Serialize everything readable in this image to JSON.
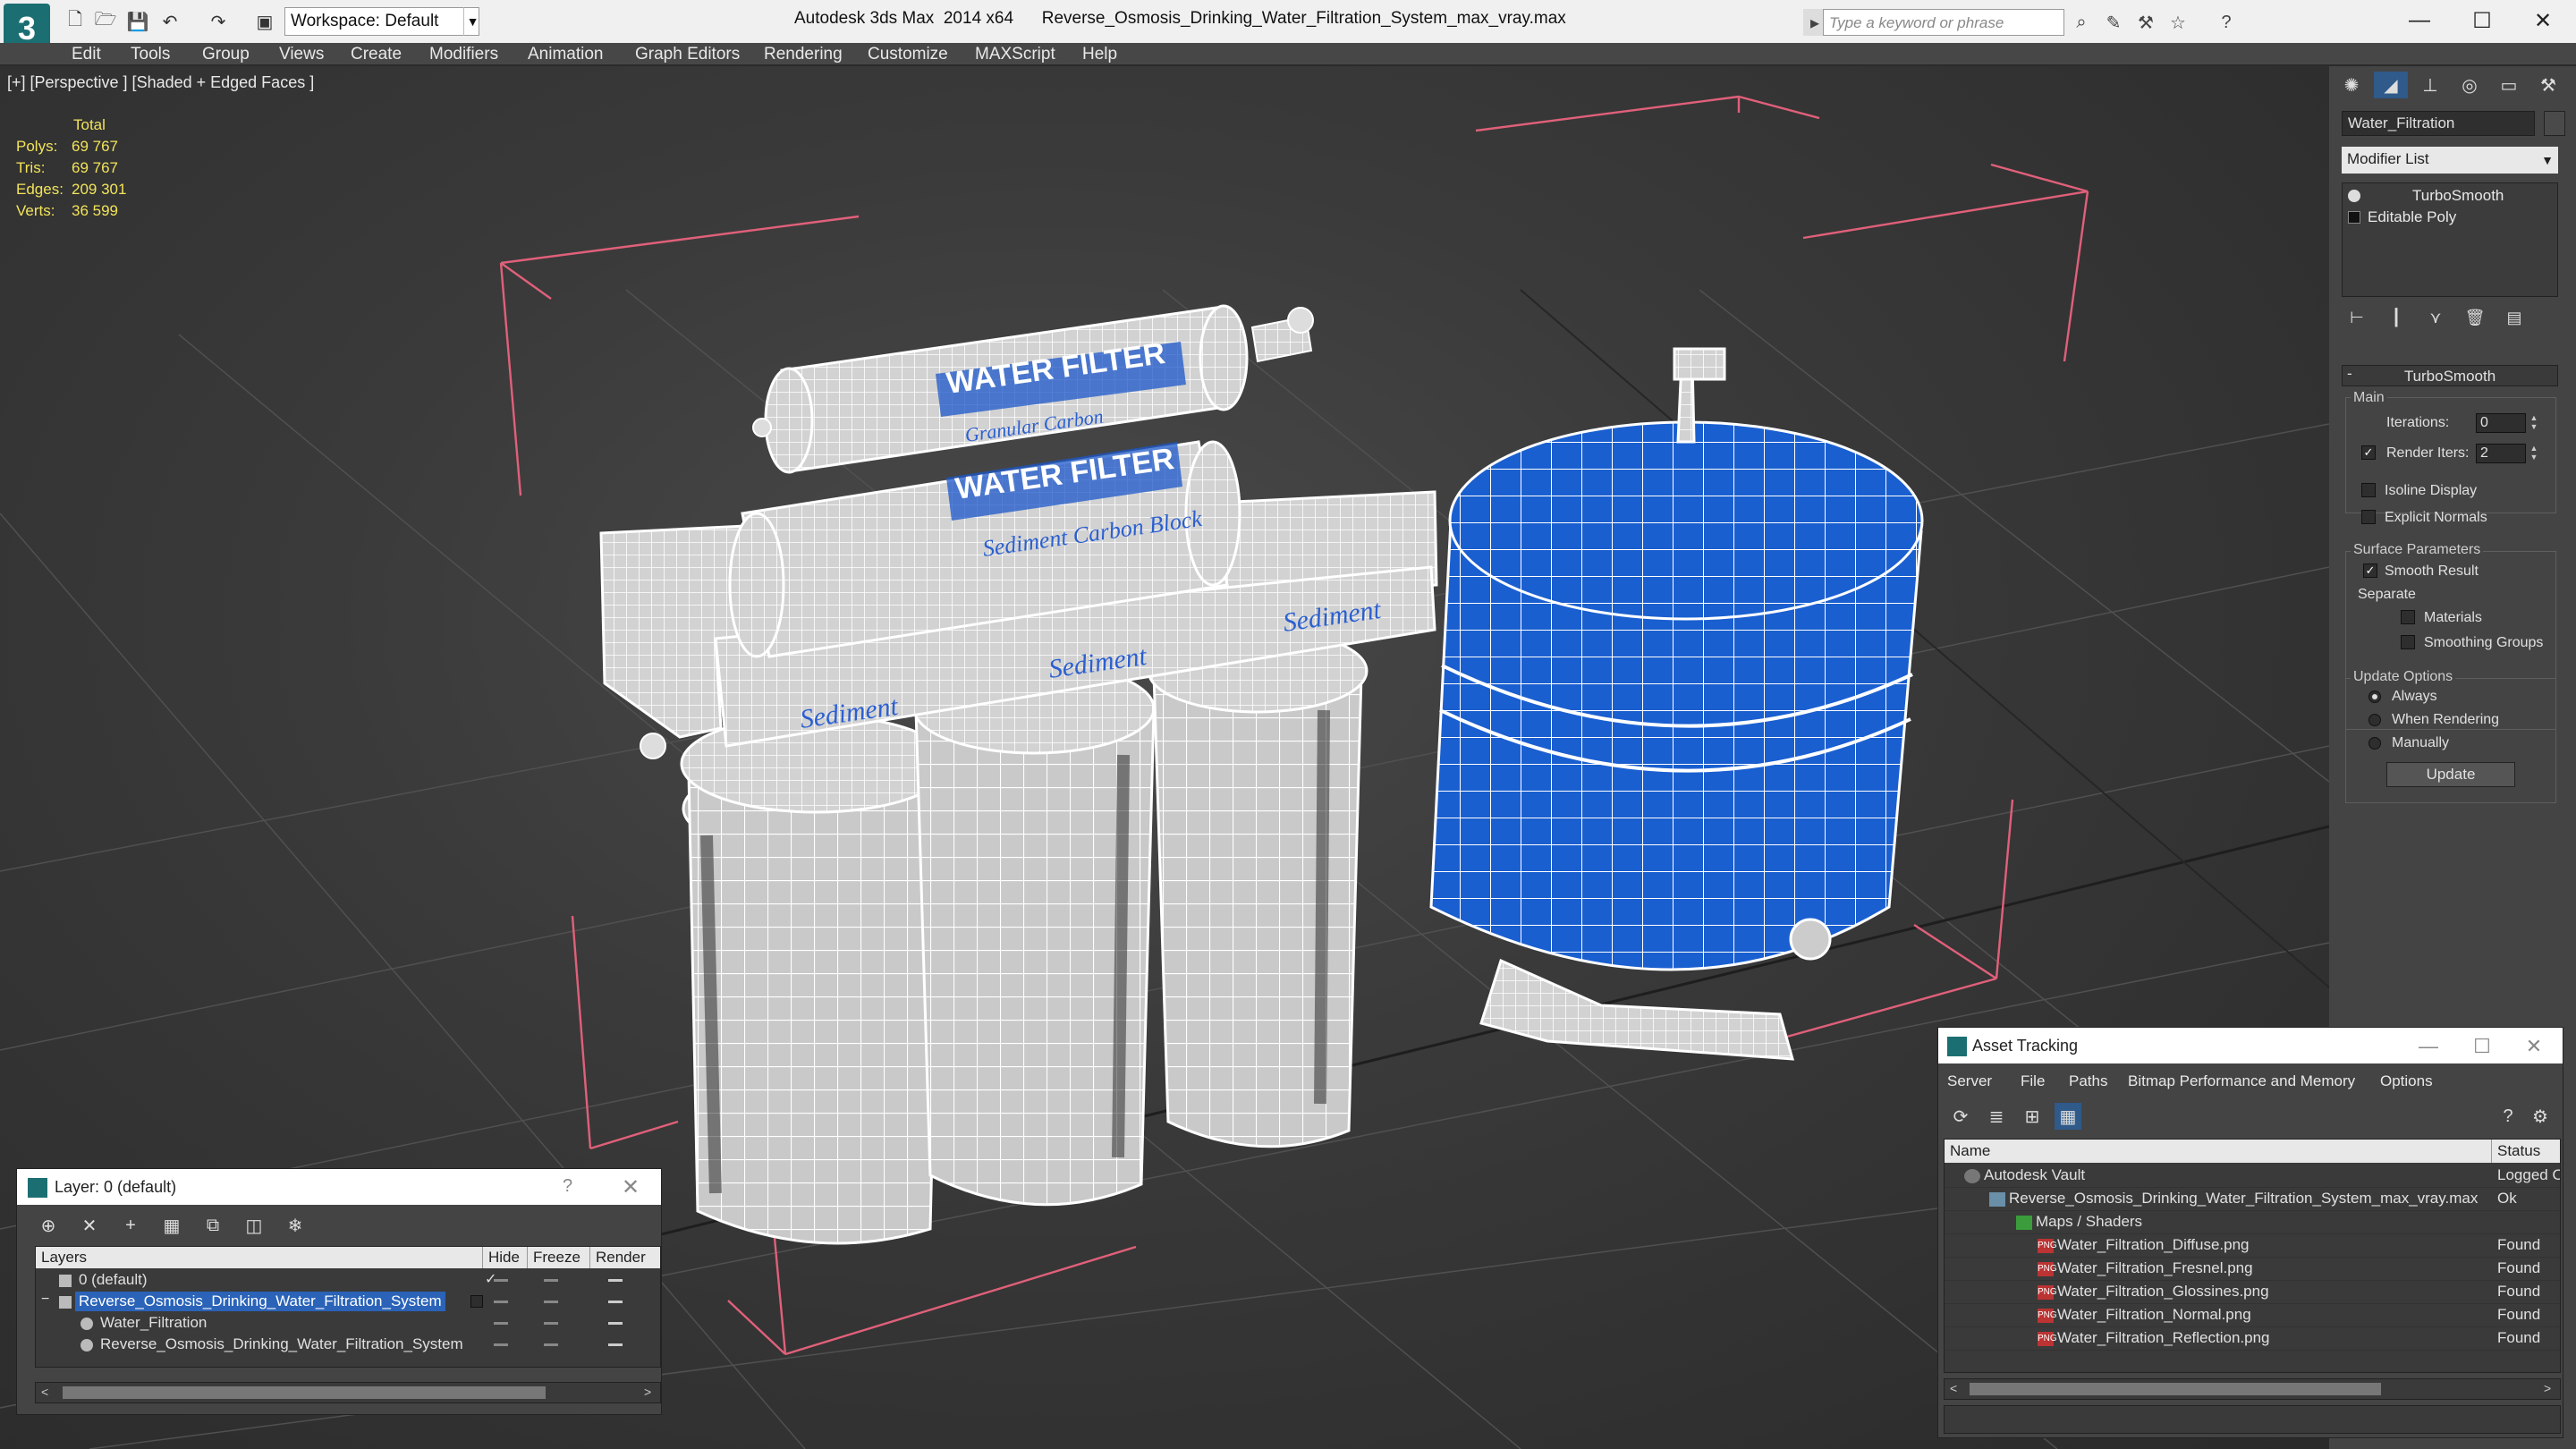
{
  "titlebar": {
    "workspace": "Workspace: Default",
    "app_title": "Autodesk 3ds Max  2014 x64",
    "file_name": "Reverse_Osmosis_Drinking_Water_Filtration_System_max_vray.max",
    "search_placeholder": "Type a keyword or phrase"
  },
  "menu": [
    "Edit",
    "Tools",
    "Group",
    "Views",
    "Create",
    "Modifiers",
    "Animation",
    "Graph Editors",
    "Rendering",
    "Customize",
    "MAXScript",
    "Help"
  ],
  "viewport": {
    "label": "[+] [Perspective ] [Shaded + Edged Faces ]",
    "stats_header": "Total",
    "stats": [
      {
        "label": "Polys:",
        "value": "69 767"
      },
      {
        "label": "Tris:",
        "value": "69 767"
      },
      {
        "label": "Edges:",
        "value": "209 301"
      },
      {
        "label": "Verts:",
        "value": "36 599"
      }
    ],
    "filter_labels": [
      "WATER FILTER",
      "WATER FILTER",
      "Sediment Carbon Block",
      "Granular Carbon"
    ],
    "housing_labels": [
      "Sediment",
      "Sediment",
      "Sediment"
    ],
    "tank_color": "#1a5fd0",
    "wire_color": "#ffffff",
    "bbox_color": "#e0607a"
  },
  "command_panel": {
    "object_name": "Water_Filtration",
    "modifier_list": "Modifier List",
    "stack": [
      "TurboSmooth",
      "Editable Poly"
    ],
    "rollout_title": "TurboSmooth",
    "main_group": "Main",
    "iterations_label": "Iterations:",
    "iterations_value": "0",
    "render_iters_label": "Render Iters:",
    "render_iters_value": "2",
    "isoline_display": "Isoline Display",
    "explicit_normals": "Explicit Normals",
    "surface_group": "Surface Parameters",
    "smooth_result": "Smooth Result",
    "separate_label": "Separate",
    "materials": "Materials",
    "smoothing_groups": "Smoothing Groups",
    "update_group": "Update Options",
    "always": "Always",
    "when_rendering": "When Rendering",
    "manually": "Manually",
    "update_button": "Update"
  },
  "layer_dialog": {
    "title": "Layer: 0 (default)",
    "help": "?",
    "columns": [
      "Layers",
      "Hide",
      "Freeze",
      "Render"
    ],
    "rows": [
      "0 (default)",
      "Reverse_Osmosis_Drinking_Water_Filtration_System",
      "Water_Filtration",
      "Reverse_Osmosis_Drinking_Water_Filtration_System"
    ]
  },
  "asset_dialog": {
    "title": "Asset Tracking",
    "menu": [
      "Server",
      "File",
      "Paths",
      "Bitmap Performance and Memory",
      "Options"
    ],
    "help": "?",
    "columns": [
      "Name",
      "Status"
    ],
    "rows": [
      {
        "name": "Autodesk Vault",
        "status": "Logged Out"
      },
      {
        "name": "Reverse_Osmosis_Drinking_Water_Filtration_System_max_vray.max",
        "status": "Ok"
      },
      {
        "name": "Maps / Shaders",
        "status": ""
      },
      {
        "name": "Water_Filtration_Diffuse.png",
        "status": "Found"
      },
      {
        "name": "Water_Filtration_Fresnel.png",
        "status": "Found"
      },
      {
        "name": "Water_Filtration_Glossines.png",
        "status": "Found"
      },
      {
        "name": "Water_Filtration_Normal.png",
        "status": "Found"
      },
      {
        "name": "Water_Filtration_Reflection.png",
        "status": "Found"
      }
    ]
  }
}
